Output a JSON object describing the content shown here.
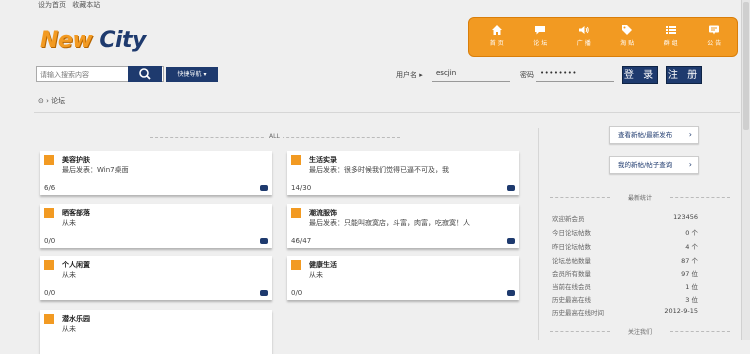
{
  "topbar": {
    "set_home": "设为首页",
    "favorite": "收藏本站"
  },
  "logo": {
    "word1": "New",
    "word2": "City"
  },
  "nav": [
    {
      "label": "首 页",
      "icon": "home-icon"
    },
    {
      "label": "论 坛",
      "icon": "forum-icon"
    },
    {
      "label": "广 播",
      "icon": "broadcast-icon"
    },
    {
      "label": "淘 贴",
      "icon": "tag-icon"
    },
    {
      "label": "群 组",
      "icon": "group-icon"
    },
    {
      "label": "公 告",
      "icon": "notice-icon"
    }
  ],
  "search": {
    "placeholder": "请输入搜索内容",
    "scope": "帖子",
    "quick_nav": "快捷导航"
  },
  "login": {
    "user_label": "用户名",
    "user_value": "escjin",
    "pw_label": "密码",
    "pw_value": "••••••••",
    "login_btn": "登 录",
    "register_btn": "注 册"
  },
  "breadcrumb": {
    "current": "论坛"
  },
  "divider_label": "ALL",
  "boards": [
    {
      "title": "美容护肤",
      "latest": "最后发表：Win7桌面",
      "stats": "6/6"
    },
    {
      "title": "生活实录",
      "latest": "最后发表：很多时候我们觉得已逼不可及，我",
      "stats": "14/30"
    },
    {
      "title": "晒客部落",
      "latest": "从未",
      "stats": "0/0"
    },
    {
      "title": "潮流服饰",
      "latest": "最后发表：只能叫寂寞店，斗富，肉富，吃寂寞！人",
      "stats": "46/47"
    },
    {
      "title": "个人闲置",
      "latest": "从未",
      "stats": "0/0"
    },
    {
      "title": "健康生活",
      "latest": "从未",
      "stats": "0/0"
    },
    {
      "title": "潜水乐园",
      "latest": "从未",
      "stats": ""
    }
  ],
  "sidebar": {
    "btn_new": "查看新帖/最新发布",
    "btn_mine": "我的新帖/帖子查询",
    "stats_title": "最新统计",
    "stats": [
      {
        "label": "欢迎新会员",
        "value": "123456"
      },
      {
        "label": "今日论坛帖数",
        "value": "0 个"
      },
      {
        "label": "昨日论坛帖数",
        "value": "4 个"
      },
      {
        "label": "论坛总帖数量",
        "value": "87 个"
      },
      {
        "label": "会员所有数量",
        "value": "97 位"
      },
      {
        "label": "当前在线会员",
        "value": "1 位"
      },
      {
        "label": "历史最高在线",
        "value": "3 位"
      },
      {
        "label": "历史最高在线时间",
        "value": "2012-9-15"
      }
    ],
    "follow_title": "关注我们"
  },
  "colors": {
    "accent": "#f29a22",
    "brand": "#1e3a6e"
  }
}
